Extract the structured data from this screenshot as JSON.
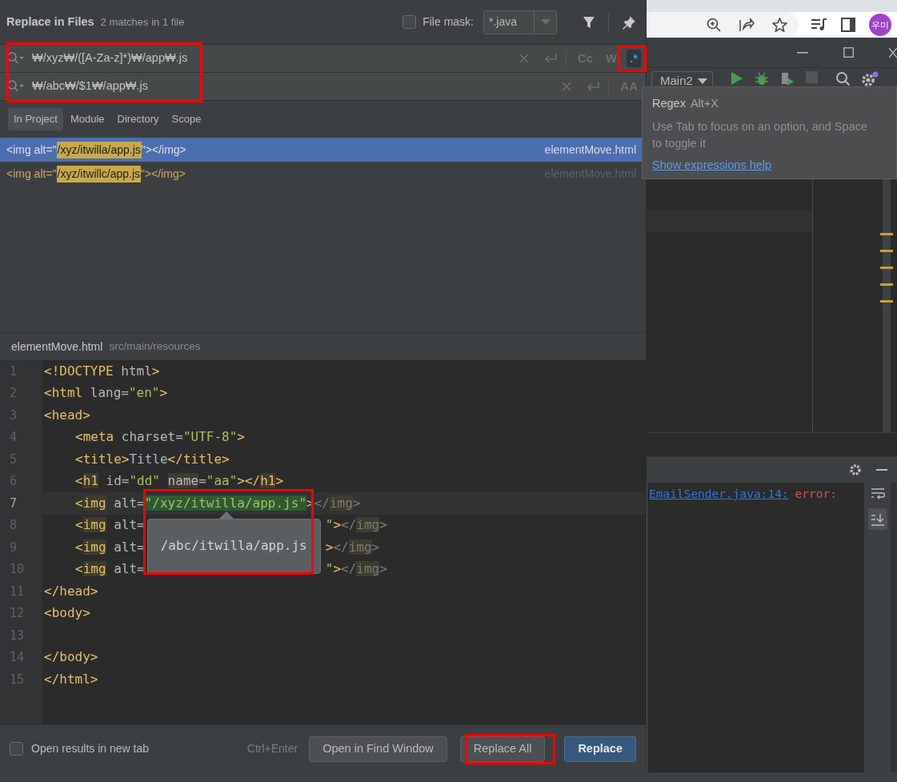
{
  "browser_bar": {
    "avatar": "우미"
  },
  "dialog": {
    "title": "Replace in Files",
    "match_summary": "2 matches in 1 file",
    "file_mask": {
      "label": "File mask:",
      "checked": false,
      "value": "*.java"
    },
    "search": {
      "value": "₩/xyz₩/([A-Za-z]*)₩/app₩.js",
      "options": [
        {
          "label": "Cc",
          "selected": false
        },
        {
          "label": "W",
          "selected": false
        },
        {
          "label": ".*",
          "selected": true
        }
      ]
    },
    "replace": {
      "value": "₩/abc₩/$1₩/app₩.js",
      "options": [
        {
          "label": "AA",
          "selected": false
        }
      ]
    },
    "scopes": [
      {
        "label": "In Project",
        "selected": true
      },
      {
        "label": "Module",
        "selected": false
      },
      {
        "label": "Directory",
        "selected": false
      },
      {
        "label": "Scope",
        "selected": false
      }
    ],
    "results": [
      {
        "prefix": "<img alt=\"",
        "match": "/xyz/itwilla/app.js",
        "suffix": "\"></img>",
        "location": "elementMove.html",
        "selected": true
      },
      {
        "prefix": "<img alt=\"",
        "match": "/xyz/itwillc/app.js",
        "suffix": "\"></img>",
        "location": "elementMove.html",
        "selected": false
      }
    ],
    "preview": {
      "file": "elementMove.html",
      "path": "src/main/resources",
      "replacement_popup": "/abc/itwilla/app.js",
      "lines": [
        {
          "number": "1",
          "current": false,
          "indented": false,
          "tokens": [
            {
              "text": "<!DOCTYPE ",
              "kind": "tag"
            },
            {
              "text": "html",
              "kind": "attr"
            },
            {
              "text": ">",
              "kind": "tag"
            }
          ]
        },
        {
          "number": "2",
          "current": false,
          "indented": false,
          "tokens": [
            {
              "text": "<html",
              "kind": "tag"
            },
            {
              "text": " lang=",
              "kind": "attr"
            },
            {
              "text": "\"en\"",
              "kind": "value"
            },
            {
              "text": ">",
              "kind": "tag"
            }
          ]
        },
        {
          "number": "3",
          "current": false,
          "indented": false,
          "tokens": [
            {
              "text": "<head>",
              "kind": "tag"
            }
          ]
        },
        {
          "number": "4",
          "current": false,
          "indented": true,
          "tokens": [
            {
              "text": "<meta",
              "kind": "tag"
            },
            {
              "text": " charset=",
              "kind": "attr"
            },
            {
              "text": "\"UTF-8\"",
              "kind": "value"
            },
            {
              "text": ">",
              "kind": "tag"
            }
          ]
        },
        {
          "number": "5",
          "current": false,
          "indented": true,
          "tokens": [
            {
              "text": "<title>",
              "kind": "tag"
            },
            {
              "text": "Title",
              "kind": "text"
            },
            {
              "text": "</title>",
              "kind": "tag"
            }
          ]
        },
        {
          "number": "6",
          "current": false,
          "indented": true,
          "tokens": [
            {
              "text": "<",
              "kind": "tag"
            },
            {
              "text": "h1",
              "kind": "tagmark"
            },
            {
              "text": " id=",
              "kind": "attr"
            },
            {
              "text": "\"dd\" ",
              "kind": "value"
            },
            {
              "text": "name",
              "kind": "attrmark"
            },
            {
              "text": "=",
              "kind": "attr"
            },
            {
              "text": "\"aa\"",
              "kind": "value"
            },
            {
              "text": "></",
              "kind": "tag"
            },
            {
              "text": "h1",
              "kind": "tagmark"
            },
            {
              "text": ">",
              "kind": "tag"
            }
          ]
        },
        {
          "number": "7",
          "current": true,
          "indented": true,
          "tokens": [
            {
              "text": "<",
              "kind": "tag"
            },
            {
              "text": "img",
              "kind": "tagmark"
            },
            {
              "text": " alt=",
              "kind": "attr"
            },
            {
              "text": "\"/xyz/itwilla/app.js\"",
              "kind": "match"
            },
            {
              "text": ">",
              "kind": "tag"
            },
            {
              "text": "</",
              "kind": "end"
            },
            {
              "text": "img",
              "kind": "endmark"
            },
            {
              "text": ">",
              "kind": "end"
            }
          ]
        },
        {
          "number": "8",
          "current": false,
          "indented": true,
          "tokens": [
            {
              "text": "<",
              "kind": "tag"
            },
            {
              "text": "img",
              "kind": "tagmark"
            },
            {
              "text": " alt=",
              "kind": "attr"
            }
          ],
          "after": [
            {
              "text": "\"",
              "kind": "value"
            },
            {
              "text": ">",
              "kind": "tag"
            },
            {
              "text": "</",
              "kind": "end"
            },
            {
              "text": "img",
              "kind": "endmark"
            },
            {
              "text": ">",
              "kind": "end"
            }
          ]
        },
        {
          "number": "9",
          "current": false,
          "indented": true,
          "tokens": [
            {
              "text": "<",
              "kind": "tag"
            },
            {
              "text": "img",
              "kind": "tagmark"
            },
            {
              "text": " alt=",
              "kind": "attr"
            }
          ],
          "after": [
            {
              "text": ">",
              "kind": "tag"
            },
            {
              "text": "</",
              "kind": "end"
            },
            {
              "text": "img",
              "kind": "endmark"
            },
            {
              "text": ">",
              "kind": "end"
            }
          ]
        },
        {
          "number": "10",
          "current": false,
          "indented": true,
          "tokens": [
            {
              "text": "<",
              "kind": "tag"
            },
            {
              "text": "img",
              "kind": "tagmark"
            },
            {
              "text": " alt=",
              "kind": "attr"
            }
          ],
          "after": [
            {
              "text": "\"",
              "kind": "value"
            },
            {
              "text": ">",
              "kind": "tag"
            },
            {
              "text": "</",
              "kind": "end"
            },
            {
              "text": "img",
              "kind": "endmark"
            },
            {
              "text": ">",
              "kind": "end"
            }
          ]
        },
        {
          "number": "11",
          "current": false,
          "indented": false,
          "tokens": [
            {
              "text": "</head>",
              "kind": "tag"
            }
          ]
        },
        {
          "number": "12",
          "current": false,
          "indented": false,
          "tokens": [
            {
              "text": "<body>",
              "kind": "tag"
            }
          ]
        },
        {
          "number": "13",
          "current": false
        },
        {
          "number": "14",
          "current": false,
          "indented": false,
          "tokens": [
            {
              "text": "</body>",
              "kind": "tag"
            }
          ]
        },
        {
          "number": "15",
          "current": false,
          "indented": false,
          "tokens": [
            {
              "text": "</html>",
              "kind": "tag"
            }
          ]
        }
      ]
    },
    "footer": {
      "new_tab": {
        "label": "Open results in new tab",
        "checked": false
      },
      "shortcut": "Ctrl+Enter",
      "buttons": [
        {
          "label": "Open in Find Window",
          "kind": "normal"
        },
        {
          "label": "Replace All",
          "kind": "normal"
        },
        {
          "label": "Replace",
          "kind": "default"
        }
      ]
    }
  },
  "ide": {
    "run_config": "Main2",
    "tooltip": {
      "title": "Regex",
      "shortcut": "Alt+X",
      "text": "Use Tab to focus on an option, and Space to toggle it",
      "link": "Show expressions help"
    },
    "console": {
      "link": "EmailSender.java:14:",
      "error": "error:"
    }
  }
}
